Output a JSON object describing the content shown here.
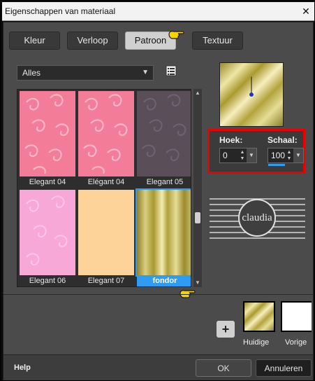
{
  "window": {
    "title": "Eigenschappen van materiaal"
  },
  "tabs": [
    {
      "label": "Kleur",
      "active": false
    },
    {
      "label": "Verloop",
      "active": false
    },
    {
      "label": "Patroon",
      "active": true
    },
    {
      "label": "Textuur",
      "active": false
    }
  ],
  "category_dropdown": {
    "value": "Alles"
  },
  "patterns": [
    {
      "label": "Elegant 04",
      "kind": "pink-swirl",
      "selected": false
    },
    {
      "label": "Elégant 04",
      "kind": "pink-swirl",
      "selected": false
    },
    {
      "label": "Elegant 05",
      "kind": "gray-swirl",
      "selected": false
    },
    {
      "label": "Elegant 06",
      "kind": "light-pink",
      "selected": false
    },
    {
      "label": "Elegant 07",
      "kind": "peach",
      "selected": false
    },
    {
      "label": "fondor",
      "kind": "gold-stripes",
      "selected": true
    }
  ],
  "settings": {
    "angle_label": "Hoek:",
    "angle_value": "0",
    "scale_label": "Schaal:",
    "scale_value": "100"
  },
  "logo": {
    "text": "claudia"
  },
  "swatches": [
    {
      "label": "Huidige",
      "kind": "gold"
    },
    {
      "label": "Vorige",
      "kind": "white"
    }
  ],
  "add_label": "+",
  "footer": {
    "help": "Help",
    "ok": "OK",
    "cancel": "Annuleren"
  },
  "colors": {
    "accent": "#2e9cf3",
    "highlight_box": "#e00000",
    "panel": "#4b4b4b",
    "pink": "#f0708c",
    "gold": "#d8d08a"
  }
}
